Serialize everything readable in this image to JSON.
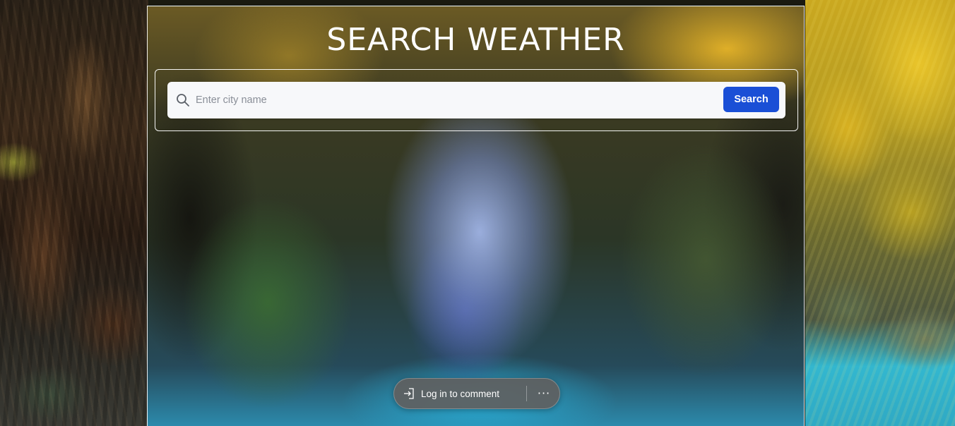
{
  "page": {
    "title": "SEARCH WEATHER"
  },
  "search": {
    "placeholder": "Enter city name",
    "value": "",
    "button_label": "Search",
    "icon": "search-icon"
  },
  "comment_bar": {
    "login_label": "Log in to comment",
    "login_icon": "login-arrow-icon",
    "more_icon": "more-horizontal-icon",
    "more_glyph": "···"
  },
  "colors": {
    "accent": "#1a4fd6",
    "title_text": "#ffffff",
    "pill_bg": "#5f5f5f"
  }
}
